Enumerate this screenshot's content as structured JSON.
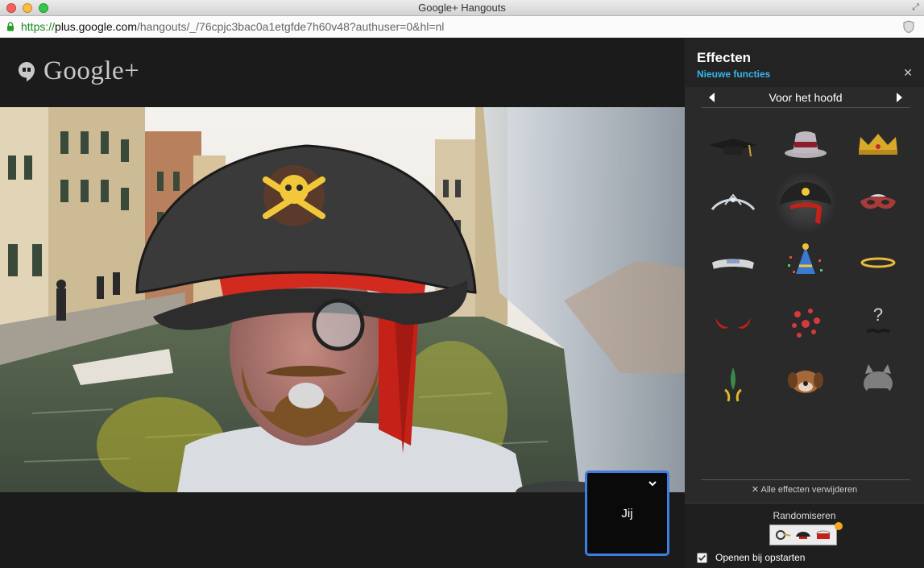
{
  "window": {
    "title": "Google+ Hangouts",
    "url_scheme": "https://",
    "url_host": "plus.google.com",
    "url_path": "/hangouts/_/76cpjc3bac0a1etgfde7h60v48?authuser=0&hl=nl"
  },
  "brand": {
    "logo_text": "Google+"
  },
  "video": {
    "self_label": "Jij"
  },
  "effects": {
    "title": "Effecten",
    "subtitle": "Nieuwe functies",
    "category": "Voor het hoofd",
    "items": [
      {
        "icon": "graduation-cap-icon"
      },
      {
        "icon": "top-hat-icon"
      },
      {
        "icon": "crown-icon"
      },
      {
        "icon": "tiara-icon"
      },
      {
        "icon": "pirate-hat-icon",
        "selected": true
      },
      {
        "icon": "masquerade-mask-icon"
      },
      {
        "icon": "google-visor-icon"
      },
      {
        "icon": "party-hat-icon"
      },
      {
        "icon": "halo-icon"
      },
      {
        "icon": "devil-horns-icon"
      },
      {
        "icon": "hearts-icon"
      },
      {
        "icon": "question-mark-icon"
      },
      {
        "icon": "feather-headdress-icon"
      },
      {
        "icon": "dog-face-icon"
      },
      {
        "icon": "cat-face-icon"
      }
    ],
    "remove_all": "✕ Alle effecten verwijderen",
    "randomize_label": "Randomiseren",
    "startup_label": "Openen bij opstarten",
    "startup_checked": true
  },
  "colors": {
    "accent_blue": "#3d7fe0",
    "link_cyan": "#37b6ee",
    "dot_orange": "#f2a818"
  }
}
